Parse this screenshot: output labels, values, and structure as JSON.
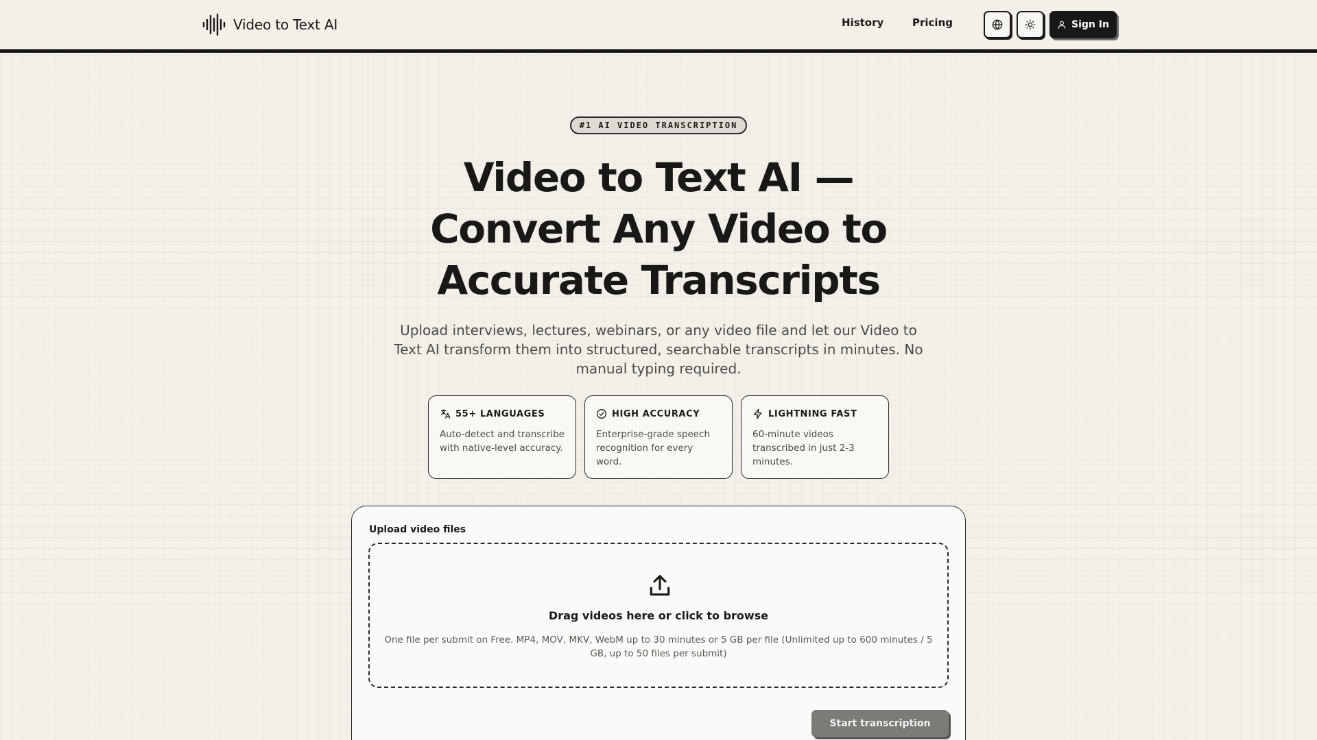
{
  "header": {
    "brand_name": "Video to Text AI",
    "nav": {
      "history": "History",
      "pricing": "Pricing"
    },
    "sign_in_label": "Sign In"
  },
  "hero": {
    "badge": "#1 AI VIDEO TRANSCRIPTION",
    "title_line_1": "Video to Text AI —",
    "title_line_2": "Convert Any Video to",
    "title_line_3": "Accurate Transcripts",
    "subtitle": "Upload interviews, lectures, webinars, or any video file and let our Video to Text AI transform them into structured, searchable transcripts in minutes. No manual typing required."
  },
  "features": [
    {
      "icon": "translate-icon",
      "title": "55+ LANGUAGES",
      "desc": "Auto-detect and transcribe with native-level accuracy."
    },
    {
      "icon": "check-circle-icon",
      "title": "HIGH ACCURACY",
      "desc": "Enterprise-grade speech recognition for every word."
    },
    {
      "icon": "lightning-icon",
      "title": "LIGHTNING FAST",
      "desc": "60-minute videos transcribed in just 2-3 minutes."
    }
  ],
  "upload": {
    "label": "Upload video files",
    "drop_title": "Drag videos here or click to browse",
    "drop_hint": "One file per submit on Free. MP4, MOV, MKV, WebM up to 30 minutes or 5 GB per file (Unlimited up to 600 minutes / 5 GB, up to 50 files per submit)",
    "start_button": "Start transcription"
  },
  "colors": {
    "background": "#f3f0ea",
    "ink": "#1c1a17",
    "primary_button": "#181818",
    "disabled_button": "#7c7b78"
  }
}
